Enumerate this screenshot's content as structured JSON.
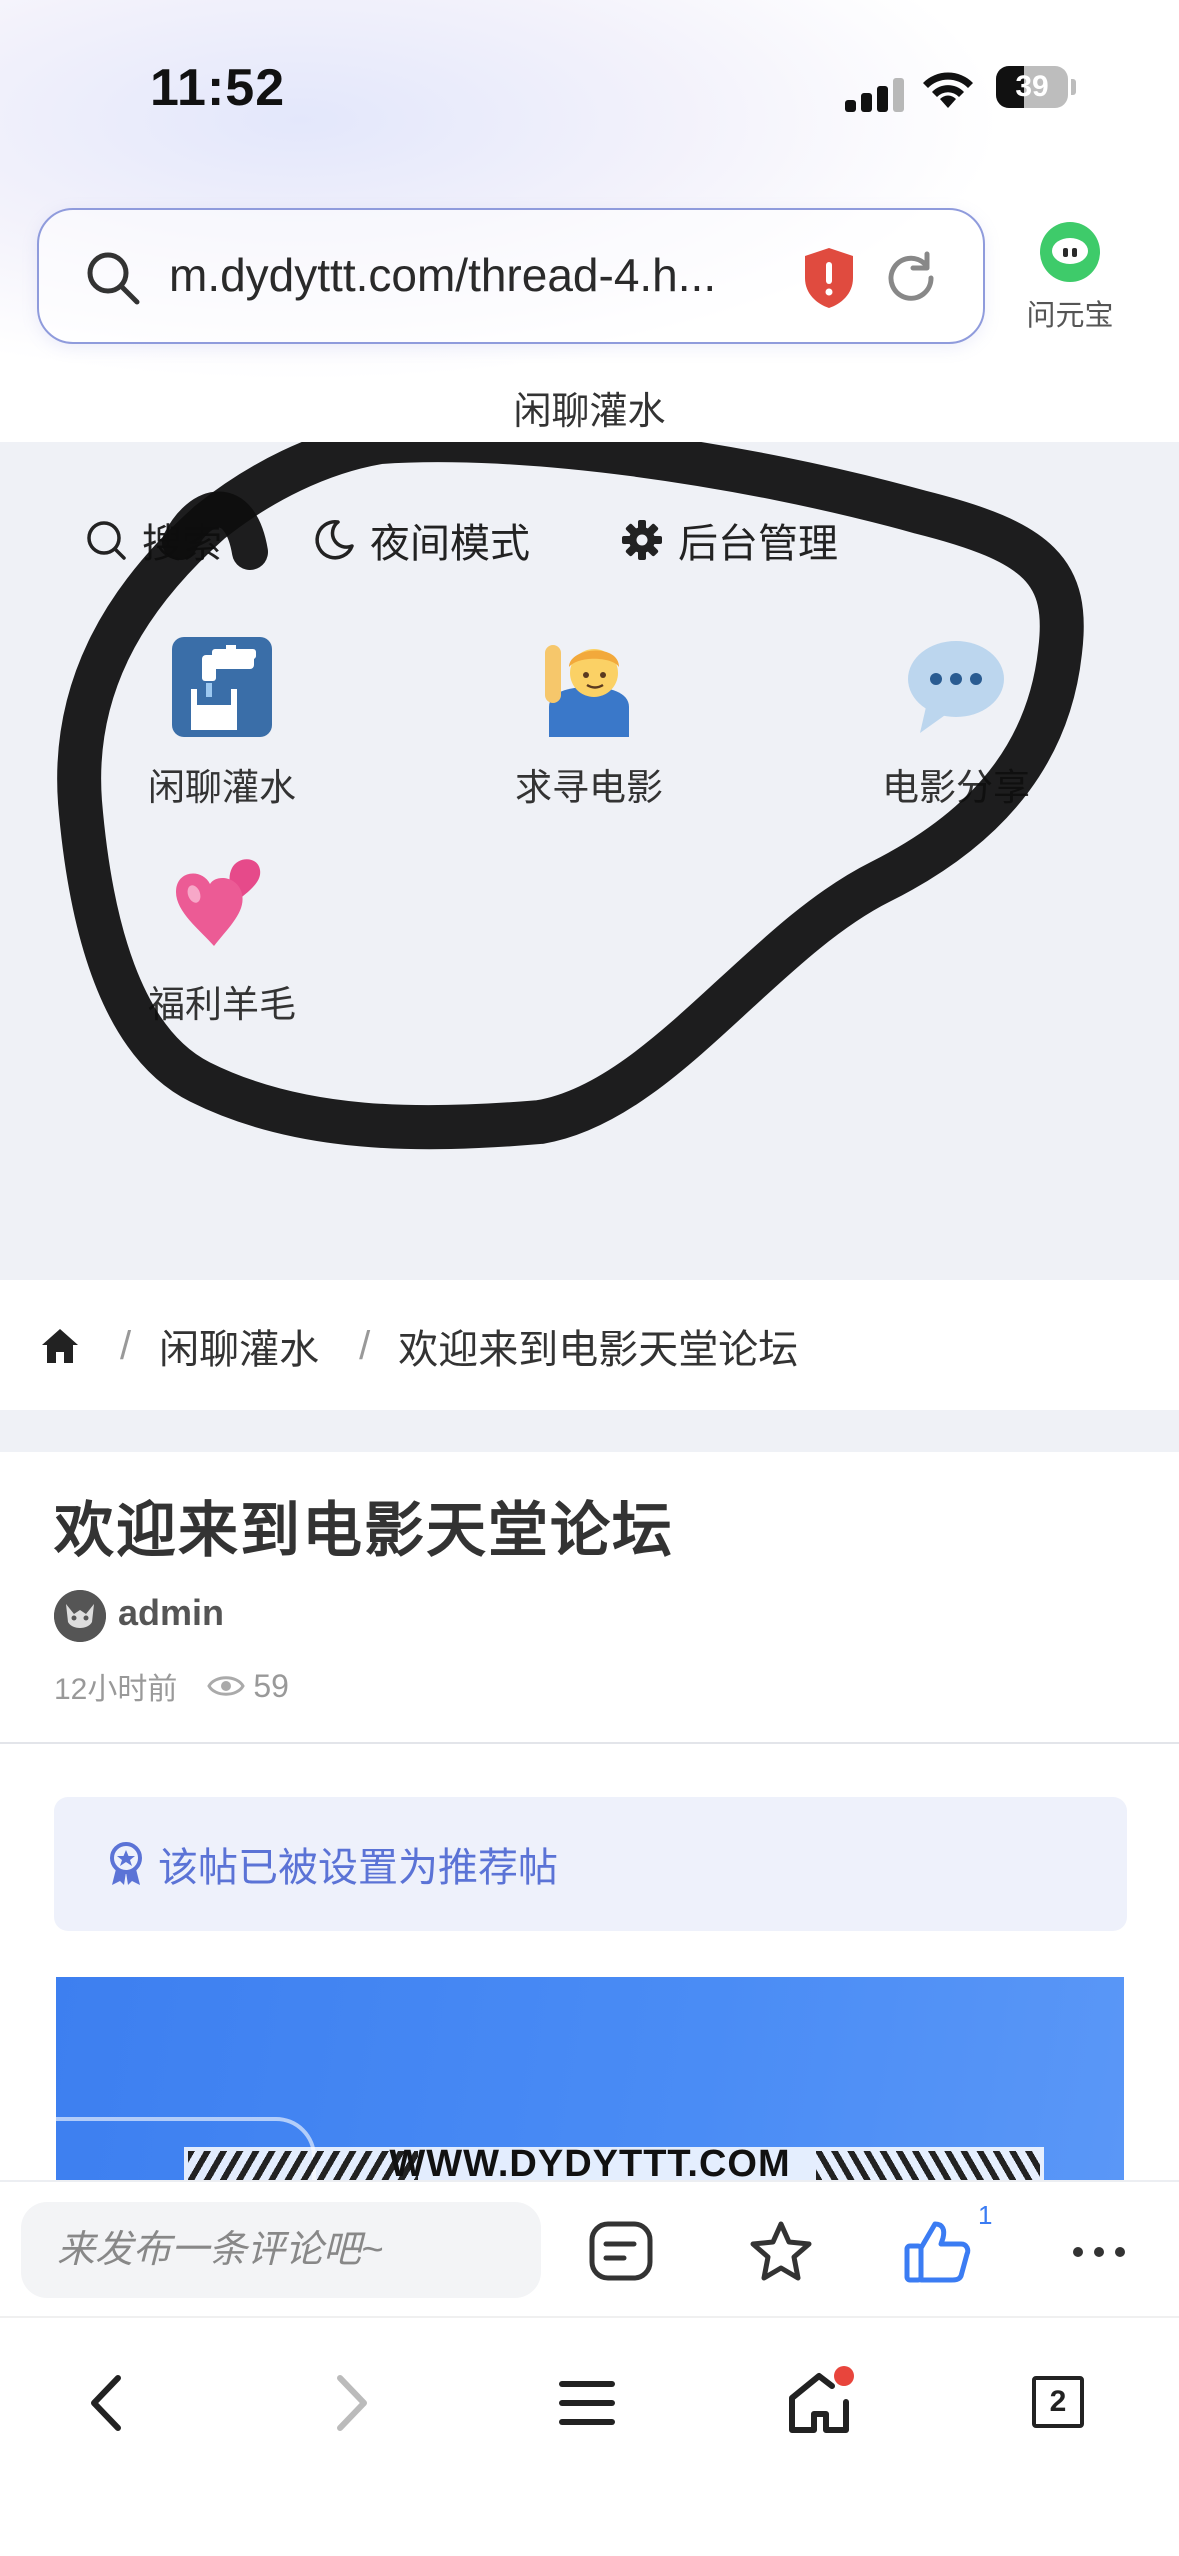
{
  "status_bar": {
    "time": "11:52",
    "battery": "39",
    "battery_level": 0.39
  },
  "browser": {
    "url": "m.dydyttt.com/thread-4.h...",
    "assistant_label": "问元宝",
    "tab_count": "2"
  },
  "page": {
    "header_title": "闲聊灌水"
  },
  "quick_links": {
    "search": "搜索",
    "night_mode": "夜间模式",
    "admin": "后台管理"
  },
  "forums": [
    {
      "label": "闲聊灌水",
      "icon": "faucet-icon"
    },
    {
      "label": "求寻电影",
      "icon": "raising-hand-icon"
    },
    {
      "label": "电影分享",
      "icon": "speech-bubble-icon"
    },
    {
      "label": "福利羊毛",
      "icon": "two-hearts-icon"
    }
  ],
  "breadcrumb": {
    "home_icon": "home-icon",
    "level1": "闲聊灌水",
    "level2": "欢迎来到电影天堂论坛",
    "separator": "/"
  },
  "post": {
    "title": "欢迎来到电影天堂论坛",
    "author": "admin",
    "time": "12小时前",
    "views": "59",
    "recommend_notice": "该帖已被设置为推荐帖",
    "banner_text": "WWW.DYDYTTT.COM"
  },
  "comment_bar": {
    "placeholder": "来发布一条评论吧~",
    "like_count": "1"
  },
  "colors": {
    "accent": "#3b7cf3",
    "notice_text": "#5b73d6",
    "nav_bg": "#eff1f6",
    "badge_red": "#e8453c"
  }
}
